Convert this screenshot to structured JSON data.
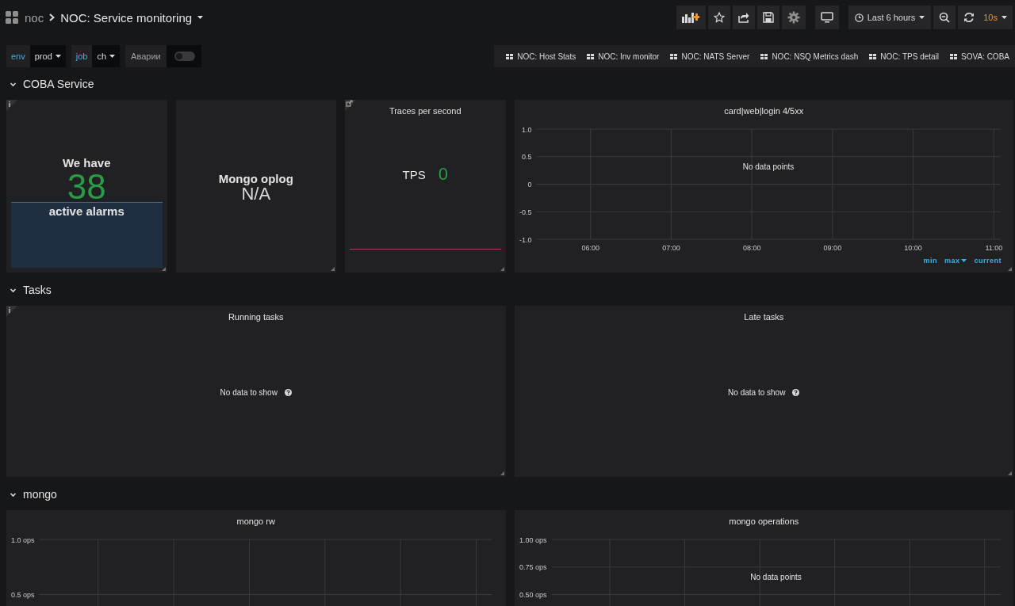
{
  "topbar": {
    "home": "noc",
    "title": "NOC: Service monitoring",
    "time_range": "Last 6 hours",
    "refresh": "10s"
  },
  "variables": [
    {
      "kind": "select",
      "label": "env",
      "value": "prod"
    },
    {
      "kind": "select",
      "label": "job",
      "value": "ch"
    },
    {
      "kind": "switch",
      "label": "Аварии",
      "on": false
    }
  ],
  "links": [
    "NOC: Host Stats",
    "NOC: Inv monitor",
    "NOC: NATS Server",
    "NOC: NSQ Metrics dash",
    "NOC: TPS detail",
    "SOVA: COBA"
  ],
  "rows": [
    {
      "title": "COBA Service",
      "expanded": true,
      "panels": [
        {
          "kind": "stat",
          "info": true,
          "inline": false,
          "prefix": "We have",
          "value": "38",
          "postfix": "active alarms",
          "color": "#299c46",
          "sparkline": true,
          "spark_filled": true
        },
        {
          "kind": "stat",
          "inline": false,
          "prefix": "Mongo oplog",
          "value": "N/A",
          "color": "#d8d9da"
        },
        {
          "kind": "stat",
          "link": true,
          "title": "Traces per second",
          "inline": true,
          "prefix": "TPS",
          "value": "0",
          "color": "#299c46",
          "sparkline": true,
          "spark_filled": false
        },
        {
          "kind": "graph",
          "message": "No data points",
          "legend": [
            {
              "label": "min",
              "sorted": false
            },
            {
              "label": "max",
              "sorted": true
            },
            {
              "label": "current",
              "sorted": false
            }
          ],
          "chart_data": {
            "type": "line",
            "title": "card|web|login 4/5xx",
            "grid": true,
            "xlim": [
              5.33,
              11.08
            ],
            "ylim": [
              -1,
              1
            ],
            "xticks": [
              {
                "value": 6,
                "label": "06:00"
              },
              {
                "value": 7,
                "label": "07:00"
              },
              {
                "value": 8,
                "label": "08:00"
              },
              {
                "value": 9,
                "label": "09:00"
              },
              {
                "value": 10,
                "label": "10:00"
              },
              {
                "value": 11,
                "label": "11:00"
              }
            ],
            "yticks": [
              {
                "value": 1,
                "label": "1.0"
              },
              {
                "value": 0.5,
                "label": "0.5"
              },
              {
                "value": 0,
                "label": "0"
              },
              {
                "value": -0.5,
                "label": "-0.5"
              },
              {
                "value": -1,
                "label": "-1.0"
              }
            ]
          }
        }
      ]
    },
    {
      "title": "Tasks",
      "expanded": true,
      "panels": [
        {
          "kind": "empty",
          "info": true,
          "title": "Running tasks",
          "message": "No data to show"
        },
        {
          "kind": "empty",
          "title": "Late tasks",
          "message": "No data to show"
        }
      ]
    },
    {
      "title": "mongo",
      "expanded": true,
      "panels": [
        {
          "kind": "graph",
          "chart_data": {
            "type": "line",
            "title": "mongo rw",
            "grid": true,
            "categories": [
              null,
              null,
              null,
              null,
              null,
              null
            ],
            "ylim": [
              0,
              1
            ],
            "yticks": [
              {
                "value": 1,
                "label": "1.0 ops"
              },
              {
                "value": 0.5,
                "label": "0.5 ops"
              }
            ]
          }
        },
        {
          "kind": "graph",
          "message": "No data points",
          "chart_data": {
            "type": "line",
            "title": "mongo operations",
            "grid": true,
            "categories": [
              null,
              null,
              null,
              null,
              null,
              null
            ],
            "ylim": [
              0,
              1
            ],
            "yticks": [
              {
                "value": 1,
                "label": "1.00 ops"
              },
              {
                "value": 0.75,
                "label": "0.75 ops"
              },
              {
                "value": 0.5,
                "label": "0.50 ops"
              }
            ]
          }
        }
      ]
    }
  ]
}
